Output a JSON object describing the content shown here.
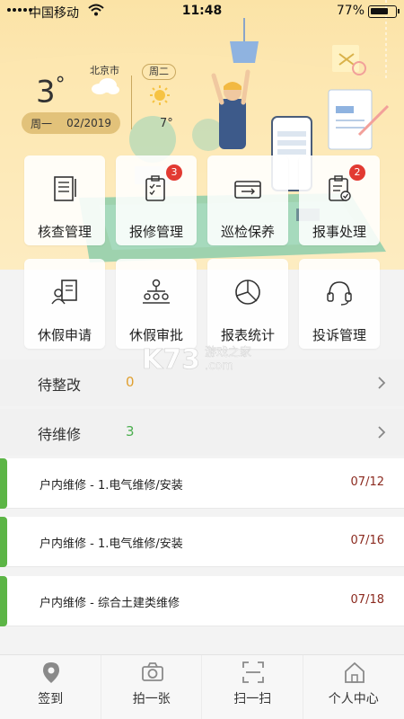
{
  "status_bar": {
    "carrier": "中国移动",
    "time": "11:48",
    "battery": "77%",
    "battery_level": 0.77
  },
  "weather": {
    "temp": "3",
    "degree": "°",
    "city": "北京市",
    "weekday": "周一",
    "date": "02/2019",
    "next_day": "周二",
    "next_temp": "7°"
  },
  "grid": [
    {
      "label": "核查管理",
      "icon": "document-list-icon"
    },
    {
      "label": "报修管理",
      "icon": "clipboard-check-icon",
      "badge": "3"
    },
    {
      "label": "巡检保养",
      "icon": "toolbox-wrench-icon"
    },
    {
      "label": "报事处理",
      "icon": "clipboard-approve-icon",
      "badge": "2"
    },
    {
      "label": "休假申请",
      "icon": "person-form-icon"
    },
    {
      "label": "休假审批",
      "icon": "org-chart-icon"
    },
    {
      "label": "报表统计",
      "icon": "pie-chart-icon"
    },
    {
      "label": "投诉管理",
      "icon": "headset-icon"
    }
  ],
  "sections": [
    {
      "title": "待整改",
      "count": "0",
      "count_color": "#e0a030"
    },
    {
      "title": "待维修",
      "count": "3",
      "count_color": "#4caf50"
    }
  ],
  "repairs": [
    {
      "title": "户内维修 - 1.电气维修/安装",
      "date": "07/12"
    },
    {
      "title": "户内维修 - 1.电气维修/安装",
      "date": "07/16"
    },
    {
      "title": "户内维修 - 综合土建类维修",
      "date": "07/18"
    }
  ],
  "watermark": {
    "brand": "K73",
    "site": "游戏之家",
    "domain": ".com"
  },
  "tabs": [
    {
      "label": "签到",
      "icon": "location-pin-icon"
    },
    {
      "label": "拍一张",
      "icon": "camera-icon"
    },
    {
      "label": "扫一扫",
      "icon": "scan-icon"
    },
    {
      "label": "个人中心",
      "icon": "home-icon"
    }
  ]
}
